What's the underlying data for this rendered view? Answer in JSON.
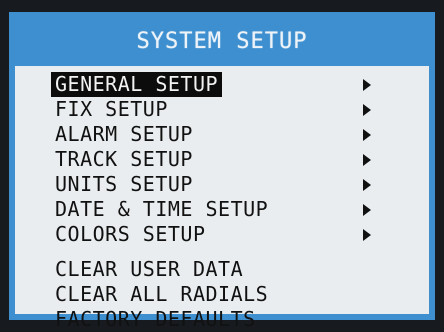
{
  "title": "SYSTEM SETUP",
  "colors": {
    "frame": "#3d8fd0",
    "background": "#e9edef",
    "highlight": "#0c0c0c",
    "text": "#111111"
  },
  "menu": {
    "submenus": [
      {
        "label": "GENERAL SETUP",
        "selected": true,
        "icon": "play-triangle-icon"
      },
      {
        "label": "FIX SETUP",
        "selected": false,
        "icon": "play-triangle-icon"
      },
      {
        "label": "ALARM SETUP",
        "selected": false,
        "icon": "play-triangle-icon"
      },
      {
        "label": "TRACK SETUP",
        "selected": false,
        "icon": "play-triangle-icon"
      },
      {
        "label": "UNITS SETUP",
        "selected": false,
        "icon": "play-triangle-icon"
      },
      {
        "label": "DATE & TIME SETUP",
        "selected": false,
        "icon": "play-triangle-icon"
      },
      {
        "label": "COLORS SETUP",
        "selected": false,
        "icon": "play-triangle-icon"
      }
    ],
    "actions": [
      {
        "label": "CLEAR USER DATA"
      },
      {
        "label": "CLEAR ALL RADIALS"
      },
      {
        "label": "FACTORY DEFAULTS"
      }
    ]
  }
}
